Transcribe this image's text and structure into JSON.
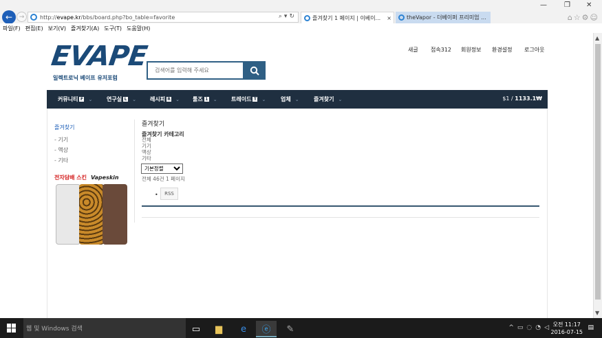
{
  "browser": {
    "url_prefix": "http://",
    "url_domain": "evape.kr",
    "url_path": "/bbs/board.php?bo_table=favorite",
    "tabs": [
      {
        "title": "즐겨찾기 1 페이지 | 이베이...",
        "close": "×"
      },
      {
        "title": "theVapor - 더베이퍼 프리미엄 ...",
        "close": ""
      }
    ],
    "window_controls": {
      "minimize": "—",
      "restore": "❐",
      "close": "✕"
    },
    "menu": [
      "파일(F)",
      "편집(E)",
      "보기(V)",
      "즐겨찾기(A)",
      "도구(T)",
      "도움말(H)"
    ]
  },
  "site": {
    "logo_text": "EVAPE",
    "logo_sub": "일렉트로닉 베이프 유저포럼",
    "search_placeholder": "검색어를 입력해 주세요",
    "top_links": [
      "새글",
      "접속312",
      "회원정보",
      "환경설정",
      "로그아웃"
    ],
    "nav": [
      {
        "label": "커뮤니티",
        "badge": "F"
      },
      {
        "label": "연구실",
        "badge": "L"
      },
      {
        "label": "레시피",
        "badge": "R"
      },
      {
        "label": "툴즈",
        "badge": "1"
      },
      {
        "label": "트레이드",
        "badge": "T"
      },
      {
        "label": "업체",
        "badge": ""
      },
      {
        "label": "즐겨찾기",
        "badge": ""
      }
    ],
    "balance_prefix": "$1 / ",
    "balance_value": "1133.1₩"
  },
  "sidebar": {
    "title": "즐겨찾기",
    "items": [
      "- 기기",
      "- 액상",
      "- 기타"
    ],
    "ad_head": "전자담배 스킨",
    "ad_brand": "Vapeskin"
  },
  "content": {
    "title": "즐겨찾기",
    "category_title": "즐겨찾기 카테고리",
    "categories": [
      "전체",
      "기기",
      "액상",
      "기타"
    ],
    "sort_selected": "기본정렬",
    "count": "전체 46건 1 페이지",
    "rss": "RSS"
  },
  "taskbar": {
    "search_placeholder": "웹 및 Windows 검색",
    "time": "오전 11:17",
    "date": "2016-07-15"
  },
  "colors": {
    "brand": "#1b4a78",
    "nav_bg": "#1f2f40",
    "search_blue": "#2f5f84",
    "link_blue": "#1e5fb8"
  }
}
